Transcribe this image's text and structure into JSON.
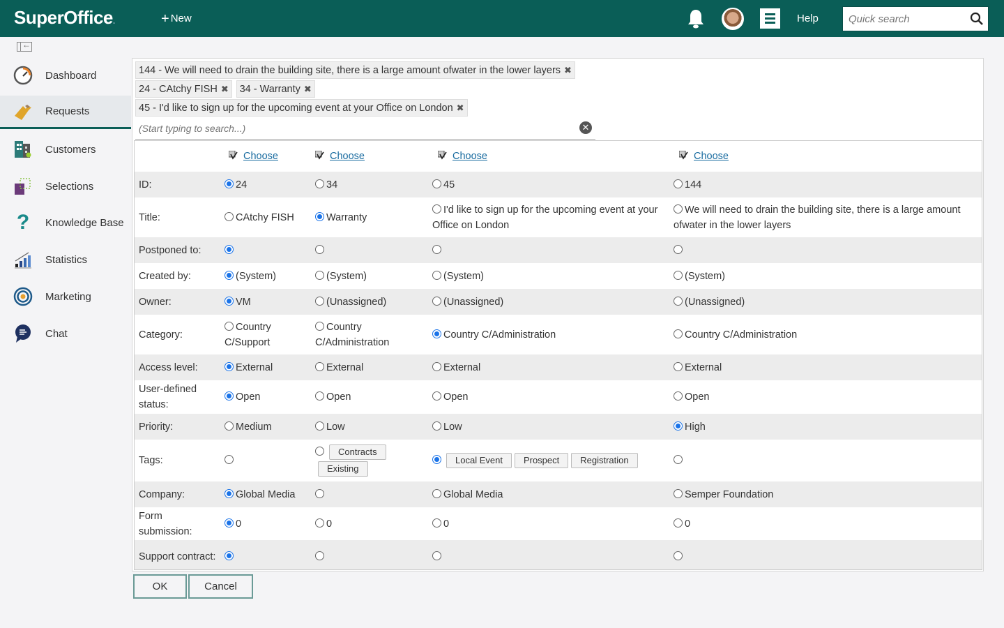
{
  "topbar": {
    "logo": "SuperOffice",
    "logo_dot": ".",
    "new_label": "New",
    "help_label": "Help",
    "search_placeholder": "Quick search"
  },
  "sidebar": {
    "items": [
      {
        "label": "Dashboard",
        "icon": "dashboard-gauge-icon"
      },
      {
        "label": "Requests",
        "icon": "ticket-icon",
        "active": true
      },
      {
        "label": "Customers",
        "icon": "buildings-icon"
      },
      {
        "label": "Selections",
        "icon": "selection-icon"
      },
      {
        "label": "Knowledge Base",
        "icon": "question-mark-icon"
      },
      {
        "label": "Statistics",
        "icon": "bar-chart-icon"
      },
      {
        "label": "Marketing",
        "icon": "target-icon"
      },
      {
        "label": "Chat",
        "icon": "chat-bubble-icon"
      }
    ]
  },
  "selected_requests": [
    "144 - We will need to drain the building site, there is a large amount ofwater in the lower layers",
    "24 - CAtchy FISH",
    "34 - Warranty",
    "45 - I'd like to sign up for the upcoming event at your Office on London"
  ],
  "search": {
    "placeholder": "(Start typing to search...)"
  },
  "grid": {
    "choose_label": "Choose",
    "rows": [
      {
        "label": "ID:",
        "cells": [
          {
            "v": "24",
            "on": true
          },
          {
            "v": "34"
          },
          {
            "v": "45"
          },
          {
            "v": "144"
          }
        ]
      },
      {
        "label": "Title:",
        "cells": [
          {
            "v": "CAtchy FISH"
          },
          {
            "v": "Warranty",
            "on": true
          },
          {
            "v": "I'd like to sign up for the upcoming event at your Office on London"
          },
          {
            "v": "We will need to drain the building site, there is a large amount ofwater in the lower layers"
          }
        ]
      },
      {
        "label": "Postponed to:",
        "cells": [
          {
            "v": "",
            "on": true
          },
          {
            "v": ""
          },
          {
            "v": ""
          },
          {
            "v": ""
          }
        ]
      },
      {
        "label": "Created by:",
        "cells": [
          {
            "v": "(System)",
            "on": true
          },
          {
            "v": "(System)"
          },
          {
            "v": "(System)"
          },
          {
            "v": "(System)"
          }
        ]
      },
      {
        "label": "Owner:",
        "cells": [
          {
            "v": "VM",
            "on": true
          },
          {
            "v": "(Unassigned)"
          },
          {
            "v": "(Unassigned)"
          },
          {
            "v": "(Unassigned)"
          }
        ]
      },
      {
        "label": "Category:",
        "cells": [
          {
            "v": "Country C/Support"
          },
          {
            "v": "Country C/Administration"
          },
          {
            "v": "Country C/Administration",
            "on": true
          },
          {
            "v": "Country C/Administration"
          }
        ]
      },
      {
        "label": "Access level:",
        "cells": [
          {
            "v": "External",
            "on": true
          },
          {
            "v": "External"
          },
          {
            "v": "External"
          },
          {
            "v": "External"
          }
        ]
      },
      {
        "label": "User-defined status:",
        "cells": [
          {
            "v": "Open",
            "on": true
          },
          {
            "v": "Open"
          },
          {
            "v": "Open"
          },
          {
            "v": "Open"
          }
        ]
      },
      {
        "label": "Priority:",
        "cells": [
          {
            "v": "Medium"
          },
          {
            "v": "Low"
          },
          {
            "v": "Low"
          },
          {
            "v": "High",
            "on": true
          }
        ]
      },
      {
        "label": "Tags:",
        "cells": [
          {
            "tags": []
          },
          {
            "tags": [
              "Contracts",
              "Existing"
            ]
          },
          {
            "tags": [
              "Local Event",
              "Prospect",
              "Registration"
            ],
            "on": true
          },
          {
            "tags": []
          }
        ]
      },
      {
        "label": "Company:",
        "cells": [
          {
            "v": "Global Media",
            "on": true
          },
          {
            "v": ""
          },
          {
            "v": "Global Media"
          },
          {
            "v": "Semper Foundation"
          }
        ]
      },
      {
        "label": "Form submission:",
        "cells": [
          {
            "v": "0",
            "on": true
          },
          {
            "v": "0"
          },
          {
            "v": "0"
          },
          {
            "v": "0"
          }
        ]
      },
      {
        "label": "Support contract:",
        "cells": [
          {
            "v": "",
            "on": true
          },
          {
            "v": ""
          },
          {
            "v": ""
          },
          {
            "v": ""
          }
        ]
      }
    ]
  },
  "buttons": {
    "ok": "OK",
    "cancel": "Cancel"
  },
  "colors": {
    "brand": "#0a5e57",
    "radio_selected": "#1a73e8",
    "link": "#1a6ca0"
  }
}
